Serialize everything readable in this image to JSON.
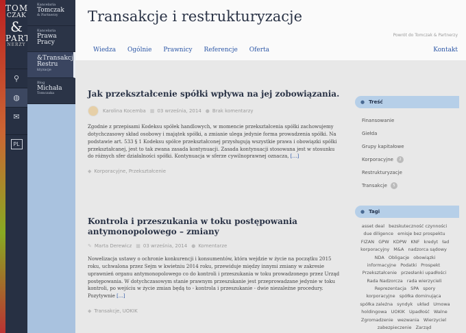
{
  "logo": {
    "line1": "TOM",
    "line2": "CZAK",
    "amp": "&",
    "line3": "PART",
    "line4": "NERZY"
  },
  "rail": {
    "buttons": [
      {
        "icon": "search-icon",
        "glyph": "⚲"
      },
      {
        "icon": "globe-icon",
        "glyph": "◍"
      },
      {
        "icon": "mail-icon",
        "glyph": "✉"
      }
    ],
    "lang": "PL"
  },
  "sites": [
    {
      "small": "Kancelaria",
      "big": "Tomczak",
      "small2": "& Partnerzy"
    },
    {
      "small": "Kancelaria",
      "big": "Prawa",
      "big2": "Pracy"
    },
    {
      "small": "",
      "big": "&Transakcje",
      "big2": "Restru",
      "small2": "ktyzacje"
    },
    {
      "small": "Blog",
      "big": "Michała",
      "small2": "Tomczaka"
    }
  ],
  "header": {
    "title": "Transakcje i restrukturyzacje",
    "back_link": "Powrót do Tomczak & Partnerzy",
    "nav": [
      "Wiedza",
      "Ogólnie",
      "Prawnicy",
      "Referencje",
      "Oferta"
    ],
    "nav_right": "Kontakt"
  },
  "posts": [
    {
      "title": "Jak przekształcenie spółki wpływa na jej zobowiązania.",
      "author": "Karolina Kocemba",
      "date": "03 września, 2014",
      "comments": "Brak komentarzy",
      "excerpt": "Zgodnie z przepisami Kodeksu spółek handlowych, w momencie przekształcenia spółki zachowujemy dotychczasowy skład osobowy i majątek spółki, a zmianie ulega jedynie forma prowadzenia spółki. Na podstawie art. 533 § 1 Kodeksu spółce przekształconej przysługują wszystkie prawa i obowiązki spółki przekształcanej, jest to tak zwana zasada kontynuacji. Zasada kontynuacji stosowana jest w stosunku do różnych sfer działalności spółki. Kontynuacja w sferze cywilnoprawnej oznacza,",
      "more": "[…]",
      "categories": "Korporacyjne, Przekształcenie"
    },
    {
      "title": "Kontrola i przeszukania w toku postępowania antymonopolowego – zmiany",
      "author": "Marta Derewicz",
      "date": "03 września, 2014",
      "comments": "Komentarze",
      "excerpt": "Nowelizacja ustawy o ochronie konkurencji i konsumentów, która wejdzie w życie na początku 2015 roku, uchwalona przez Sejm w kwietniu 2014 roku, przewiduje między innymi zmiany w zakresie uprawnień organu antymonopolowego co do kontroli i przeszukania w toku prowadzonego przez Urząd postępowania. W dotychczasowym stanie prawnym przeszukanie jest przeprowadzane jedynie w toku kontroli, po wejściu w życie zmian będą to - kontrola i przeszukanie - dwie niezależne procedury. Pozytywnie",
      "more": "[…]",
      "categories": "Transakcje, UOKIK"
    }
  ],
  "sidebar": {
    "tresc_title": "Treść",
    "tresc_items": [
      {
        "label": "Finansowanie",
        "badge": ""
      },
      {
        "label": "Giełda",
        "badge": ""
      },
      {
        "label": "Grupy kapitałowe",
        "badge": ""
      },
      {
        "label": "Korporacyjne",
        "badge": "2"
      },
      {
        "label": "Restrukturyzacje",
        "badge": ""
      },
      {
        "label": "Transakcje",
        "badge": "5"
      }
    ],
    "tags_title": "Tagi",
    "tags": [
      "asset deal",
      "bezskuteczność czynności",
      "due diligence",
      "emisje bez prospektu",
      "FIZAN",
      "GPW",
      "KDPW",
      "KNF",
      "kredyt",
      "ład korporacyjny",
      "M&A",
      "nadzorca sądowy",
      "NDA",
      "Obligacje",
      "obowiązki informacyjne",
      "Podatki",
      "Prospekt",
      "Przekształcenie",
      "przesłanki upadłości",
      "Rada Nadzorcza",
      "rada wierzycieli",
      "Reprezentacja",
      "SPA",
      "spory korporacyjne",
      "spółka dominująca",
      "spółka zależna",
      "syndyk",
      "układ",
      "Umowa holdingowa",
      "UOKIK",
      "Upadłość",
      "Walne Zgromadzenie",
      "wezwania",
      "Wierzyciel",
      "zabezpieczenie",
      "Zarząd"
    ]
  }
}
